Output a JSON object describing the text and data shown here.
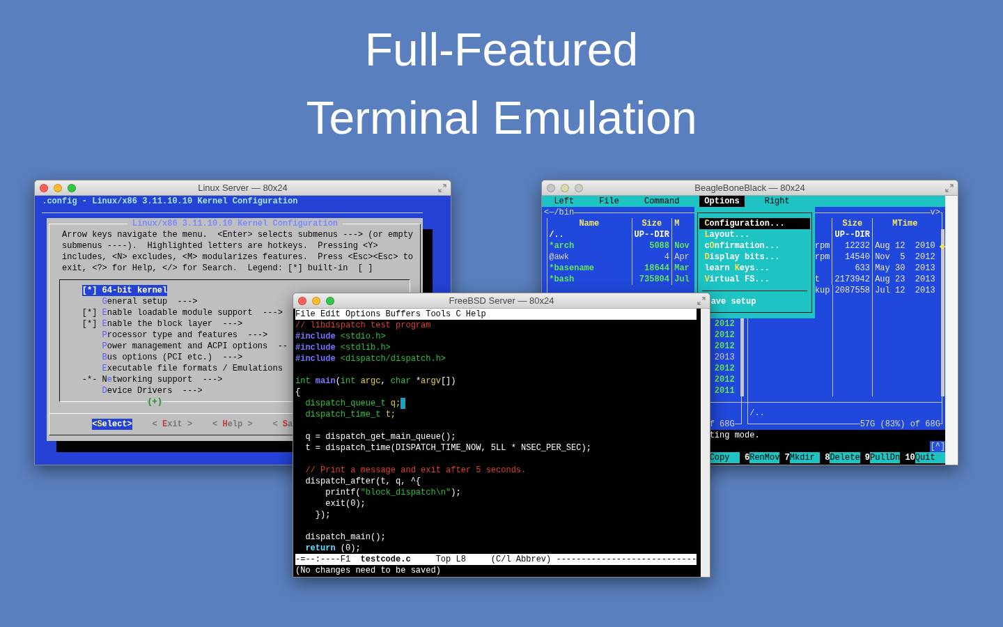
{
  "heading": [
    "Full-Featured",
    "Terminal Emulation"
  ],
  "linux_window": {
    "title": "Linux Server — 80x24",
    "buttons_dimmed": false,
    "header": ".config - Linux/x86 3.11.10.10 Kernel Configuration",
    "dialog_title": "Linux/x86 3.11.10.10 Kernel Configuration",
    "help_lines": [
      "Arrow keys navigate the menu.  <Enter> selects submenus ---> (or empty",
      "submenus ----).  Highlighted letters are hotkeys.  Pressing <Y>",
      "includes, <N> excludes, <M> modularizes features.  Press <Esc><Esc> to",
      "exit, <?> for Help, </> for Search.  Legend: [*] built-in  [ ]"
    ],
    "menu_items": [
      {
        "prefix": "[*]",
        "before": "64-",
        "hotkey": "b",
        "after": "it kernel",
        "selected": true
      },
      {
        "hotkey": "G",
        "after": "eneral setup  --->",
        "selected": false
      },
      {
        "prefix": "[*]",
        "hotkey": "E",
        "after": "nable loadable module support  --->",
        "selected": false
      },
      {
        "prefix": "[*]",
        "hotkey": "E",
        "after": "nable the block layer  --->",
        "selected": false
      },
      {
        "hotkey": "P",
        "after": "rocessor type and features  --->",
        "selected": false
      },
      {
        "hotkey": "P",
        "after": "ower management and ACPI options  --",
        "selected": false
      },
      {
        "hotkey": "B",
        "after": "us options (PCI etc.)  --->",
        "selected": false
      },
      {
        "hotkey": "E",
        "after": "xecutable file formats / Emulations",
        "selected": false
      },
      {
        "prefix": "-*-",
        "before": "N",
        "hotkey": "e",
        "after": "tworking support  --->",
        "selected": false
      },
      {
        "hotkey": "D",
        "after": "evice Drivers  --->",
        "selected": false
      }
    ],
    "more_indicator": "(+)",
    "buttons": [
      {
        "before": "<",
        "hotkey": "S",
        "after": "elect>",
        "selected": true
      },
      {
        "before": "< ",
        "hotkey": "E",
        "after": "xit >",
        "selected": false
      },
      {
        "before": "< ",
        "hotkey": "H",
        "after": "elp >",
        "selected": false
      },
      {
        "before": "< ",
        "hotkey": "S",
        "after": "a",
        "selected": false
      }
    ]
  },
  "beagle_window": {
    "title": "BeagleBoneBlack — 80x24",
    "buttons_dimmed": true,
    "menu_bar": [
      {
        "label": "Left",
        "selected": false
      },
      {
        "label": "File",
        "selected": false
      },
      {
        "label": "Command",
        "selected": false
      },
      {
        "label": "Options",
        "selected": true
      },
      {
        "label": "Right",
        "selected": false
      }
    ],
    "left_panel": {
      "path": "<─/bin",
      "columns": [
        "Name",
        "Size",
        "M"
      ],
      "rows": [
        {
          "name": "/..",
          "size": "UP--DIR",
          "kind": "updir"
        },
        {
          "name": "*arch",
          "size": "5088",
          "date": "Nov",
          "kind": "executable"
        },
        {
          "name": "@awk",
          "size": "4",
          "date": "Apr",
          "kind": "symlink"
        },
        {
          "name": "*basename",
          "size": "18644",
          "date": "Mar",
          "kind": "executable"
        },
        {
          "name": "*bash",
          "size": "735804",
          "date": "Jul",
          "kind": "executable"
        }
      ],
      "years": [
        {
          "text": "2012",
          "kind": "executable"
        },
        {
          "text": "2012",
          "kind": "executable"
        },
        {
          "text": "2012",
          "kind": "executable"
        },
        {
          "text": "2013",
          "kind": "symlink"
        },
        {
          "text": "2012",
          "kind": "executable"
        },
        {
          "text": "2012",
          "kind": "executable"
        },
        {
          "text": "2011",
          "kind": "executable"
        }
      ],
      "footer": "f 68G"
    },
    "right_panel": {
      "corner": "v>",
      "columns": [
        "Size",
        "MTime"
      ],
      "rows": [
        {
          "size": "UP--DIR",
          "kind": "updir"
        },
        {
          "name": "rpm",
          "size": "12232",
          "mtime": "Aug 12  2010",
          "kind": "file"
        },
        {
          "name": "rpm",
          "size": "14540",
          "mtime": "Nov  5  2012",
          "kind": "file"
        },
        {
          "size": "633",
          "mtime": "May 30  2013",
          "kind": "file"
        },
        {
          "name": "t",
          "size": "2173942",
          "mtime": "Aug 23  2013",
          "kind": "file"
        },
        {
          "name": "kup",
          "size": "2087558",
          "mtime": "Jul 12  2013",
          "kind": "file"
        }
      ],
      "bottom_path": "/..",
      "footer": "57G (83%) of 68G"
    },
    "options_menu": [
      {
        "kind": "item",
        "hotkey": "C",
        "after": "onfiguration...",
        "selected": true
      },
      {
        "kind": "item",
        "hotkey": "L",
        "after": "ayout...",
        "selected": false
      },
      {
        "kind": "item",
        "before": "c",
        "hotkey": "O",
        "after": "nfirmation...",
        "selected": false
      },
      {
        "kind": "item",
        "hotkey": "D",
        "after": "isplay bits...",
        "selected": false
      },
      {
        "kind": "item",
        "before": "learn ",
        "hotkey": "K",
        "after": "eys...",
        "selected": false
      },
      {
        "kind": "item",
        "hotkey": "V",
        "after": "irtual FS...",
        "selected": false
      },
      {
        "kind": "separator"
      },
      {
        "kind": "item",
        "after": "ave setup",
        "selected": false
      }
    ],
    "status_line": "ting mode.",
    "scroll_up_button": "[^]",
    "function_keys": [
      {
        "label": "Copy"
      },
      {
        "number": "6",
        "label": "RenMov"
      },
      {
        "number": "7",
        "label": "Mkdir"
      },
      {
        "number": "8",
        "label": "Delete"
      },
      {
        "number": "9",
        "label": "PullDn"
      },
      {
        "number": "10",
        "label": "Quit"
      }
    ]
  },
  "freebsd_window": {
    "title": "FreeBSD Server — 80x24",
    "buttons_dimmed": false,
    "menu_bar": [
      "File",
      "Edit",
      "Options",
      "Buffers",
      "Tools",
      "C",
      "Help"
    ],
    "code_lines": [
      {
        "kind": "code",
        "cursor": false,
        "tokens": [
          {
            "text": "// libdispatch test program",
            "kind": "comment"
          }
        ]
      },
      {
        "kind": "code",
        "cursor": false,
        "tokens": [
          {
            "text": "#include",
            "kind": "preprocessor"
          },
          {
            "text": " <stdio.h>",
            "kind": "string"
          }
        ]
      },
      {
        "kind": "code",
        "cursor": false,
        "tokens": [
          {
            "text": "#include",
            "kind": "preprocessor"
          },
          {
            "text": " <stdlib.h>",
            "kind": "string"
          }
        ]
      },
      {
        "kind": "code",
        "cursor": false,
        "tokens": [
          {
            "text": "#include",
            "kind": "preprocessor"
          },
          {
            "text": " <dispatch/dispatch.h>",
            "kind": "string"
          }
        ]
      },
      {
        "kind": "blank"
      },
      {
        "kind": "code",
        "cursor": false,
        "tokens": [
          {
            "text": "int ",
            "kind": "type"
          },
          {
            "text": "main",
            "kind": "function"
          },
          {
            "text": "(",
            "kind": "plain"
          },
          {
            "text": "int ",
            "kind": "type"
          },
          {
            "text": "argc",
            "kind": "variable"
          },
          {
            "text": ", ",
            "kind": "plain"
          },
          {
            "text": "char ",
            "kind": "type"
          },
          {
            "text": "*",
            "kind": "plain"
          },
          {
            "text": "argv",
            "kind": "variable"
          },
          {
            "text": "[])",
            "kind": "plain"
          }
        ]
      },
      {
        "kind": "code",
        "cursor": false,
        "tokens": [
          {
            "text": "{",
            "kind": "plain"
          }
        ]
      },
      {
        "kind": "code",
        "cursor": true,
        "tokens": [
          {
            "text": "  dispatch_queue_t ",
            "kind": "type"
          },
          {
            "text": "q;",
            "kind": "variable"
          }
        ]
      },
      {
        "kind": "code",
        "cursor": false,
        "tokens": [
          {
            "text": "  dispatch_time_t ",
            "kind": "type"
          },
          {
            "text": "t;",
            "kind": "variable"
          }
        ]
      },
      {
        "kind": "blank"
      },
      {
        "kind": "code",
        "cursor": false,
        "tokens": [
          {
            "text": "  q = dispatch_get_main_queue();",
            "kind": "plain"
          }
        ]
      },
      {
        "kind": "code",
        "cursor": false,
        "tokens": [
          {
            "text": "  t = dispatch_time(DISPATCH_TIME_NOW, 5LL * NSEC_PER_SEC);",
            "kind": "plain"
          }
        ]
      },
      {
        "kind": "blank"
      },
      {
        "kind": "code",
        "cursor": false,
        "tokens": [
          {
            "text": "  // Print a message and exit after 5 seconds.",
            "kind": "comment"
          }
        ]
      },
      {
        "kind": "code",
        "cursor": false,
        "tokens": [
          {
            "text": "  dispatch_after(t, q, ^{",
            "kind": "plain"
          }
        ]
      },
      {
        "kind": "code",
        "cursor": false,
        "tokens": [
          {
            "text": "      printf(",
            "kind": "plain"
          },
          {
            "text": "\"block_dispatch\\n\"",
            "kind": "string"
          },
          {
            "text": ");",
            "kind": "plain"
          }
        ]
      },
      {
        "kind": "code",
        "cursor": false,
        "tokens": [
          {
            "text": "      exit(0);",
            "kind": "plain"
          }
        ]
      },
      {
        "kind": "code",
        "cursor": false,
        "tokens": [
          {
            "text": "    });",
            "kind": "plain"
          }
        ]
      },
      {
        "kind": "blank"
      },
      {
        "kind": "code",
        "cursor": false,
        "tokens": [
          {
            "text": "  dispatch_main();",
            "kind": "plain"
          }
        ]
      },
      {
        "kind": "code",
        "cursor": false,
        "tokens": [
          {
            "text": "  return",
            "kind": "keyword"
          },
          {
            "text": " (0);",
            "kind": "plain"
          }
        ]
      }
    ],
    "mode_line": {
      "status": "-=--:----F1",
      "buffer": "testcode.c",
      "position": "Top L8",
      "mode": "(C/l Abbrev)",
      "fill": "----------------------------"
    },
    "echo_area": "(No changes need to be saved)"
  }
}
